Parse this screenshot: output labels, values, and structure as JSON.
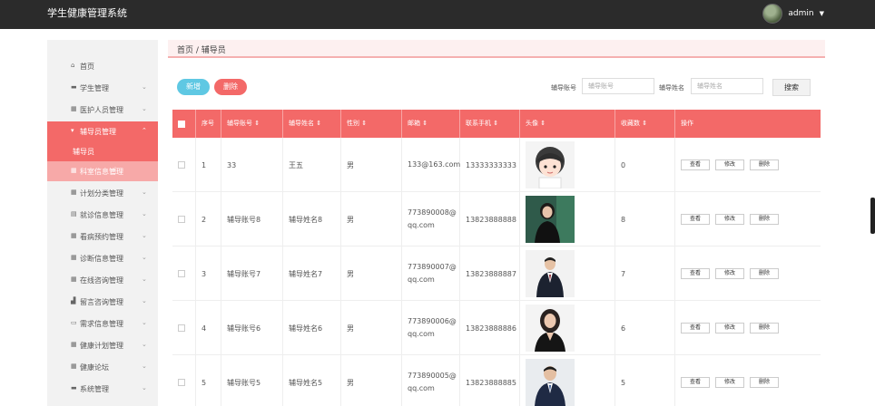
{
  "header": {
    "title": "学生健康管理系统",
    "username": "admin"
  },
  "sidebar": {
    "items": [
      {
        "label": "首页",
        "icon": "home-icon"
      },
      {
        "label": "学生管理",
        "icon": "user-icon"
      },
      {
        "label": "医护人员管理",
        "icon": "grid-icon"
      },
      {
        "label": "辅导员管理",
        "icon": "bookmark-icon",
        "active": true
      },
      {
        "label": "计划分类管理",
        "icon": "grid-icon"
      },
      {
        "label": "就诊信息管理",
        "icon": "clipboard-icon"
      },
      {
        "label": "看病预约管理",
        "icon": "grid-icon"
      },
      {
        "label": "诊断信息管理",
        "icon": "grid-icon"
      },
      {
        "label": "在线咨询管理",
        "icon": "grid-icon"
      },
      {
        "label": "留言咨询管理",
        "icon": "chart-icon"
      },
      {
        "label": "需求信息管理",
        "icon": "monitor-icon"
      },
      {
        "label": "健康计划管理",
        "icon": "grid-icon"
      },
      {
        "label": "健康论坛",
        "icon": "grid-icon"
      },
      {
        "label": "系统管理",
        "icon": "chat-icon"
      }
    ],
    "sub_items": [
      {
        "label": "辅导员"
      },
      {
        "label": "科室信息管理"
      }
    ]
  },
  "breadcrumb": "首页 / 辅导员",
  "toolbar": {
    "add_label": "新增",
    "delete_label": "删除"
  },
  "search": {
    "account_label": "辅导账号",
    "account_placeholder": "辅导账号",
    "name_label": "辅导姓名",
    "name_placeholder": "辅导姓名",
    "button_label": "搜索"
  },
  "table": {
    "columns": [
      "序号",
      "辅导账号 ⇕",
      "辅导姓名 ⇕",
      "性别 ⇕",
      "邮箱 ⇕",
      "联系手机 ⇕",
      "头像 ⇕",
      "收藏数 ⇕",
      "操作"
    ],
    "action_labels": [
      "查看",
      "修改",
      "删除"
    ],
    "rows": [
      {
        "index": "1",
        "account": "33",
        "name": "王五",
        "gender": "男",
        "email": "133@163.com",
        "phone": "13333333333",
        "favorites": "0",
        "photo": "cartoon-avatar"
      },
      {
        "index": "2",
        "account": "辅导账号8",
        "name": "辅导姓名8",
        "gender": "男",
        "email": "773890008@qq.com",
        "phone": "13823888888",
        "favorites": "8",
        "photo": "woman-portrait"
      },
      {
        "index": "3",
        "account": "辅导账号7",
        "name": "辅导姓名7",
        "gender": "男",
        "email": "773890007@qq.com",
        "phone": "13823888887",
        "favorites": "7",
        "photo": "man-portrait"
      },
      {
        "index": "4",
        "account": "辅导账号6",
        "name": "辅导姓名6",
        "gender": "男",
        "email": "773890006@qq.com",
        "phone": "13823888886",
        "favorites": "6",
        "photo": "woman-portrait"
      },
      {
        "index": "5",
        "account": "辅导账号5",
        "name": "辅导姓名5",
        "gender": "男",
        "email": "773890005@qq.com",
        "phone": "13823888885",
        "favorites": "5",
        "photo": "man-portrait"
      }
    ]
  },
  "colors": {
    "accent": "#f36968",
    "topbar": "#2b2b2b",
    "add_button": "#5fc8e3"
  }
}
